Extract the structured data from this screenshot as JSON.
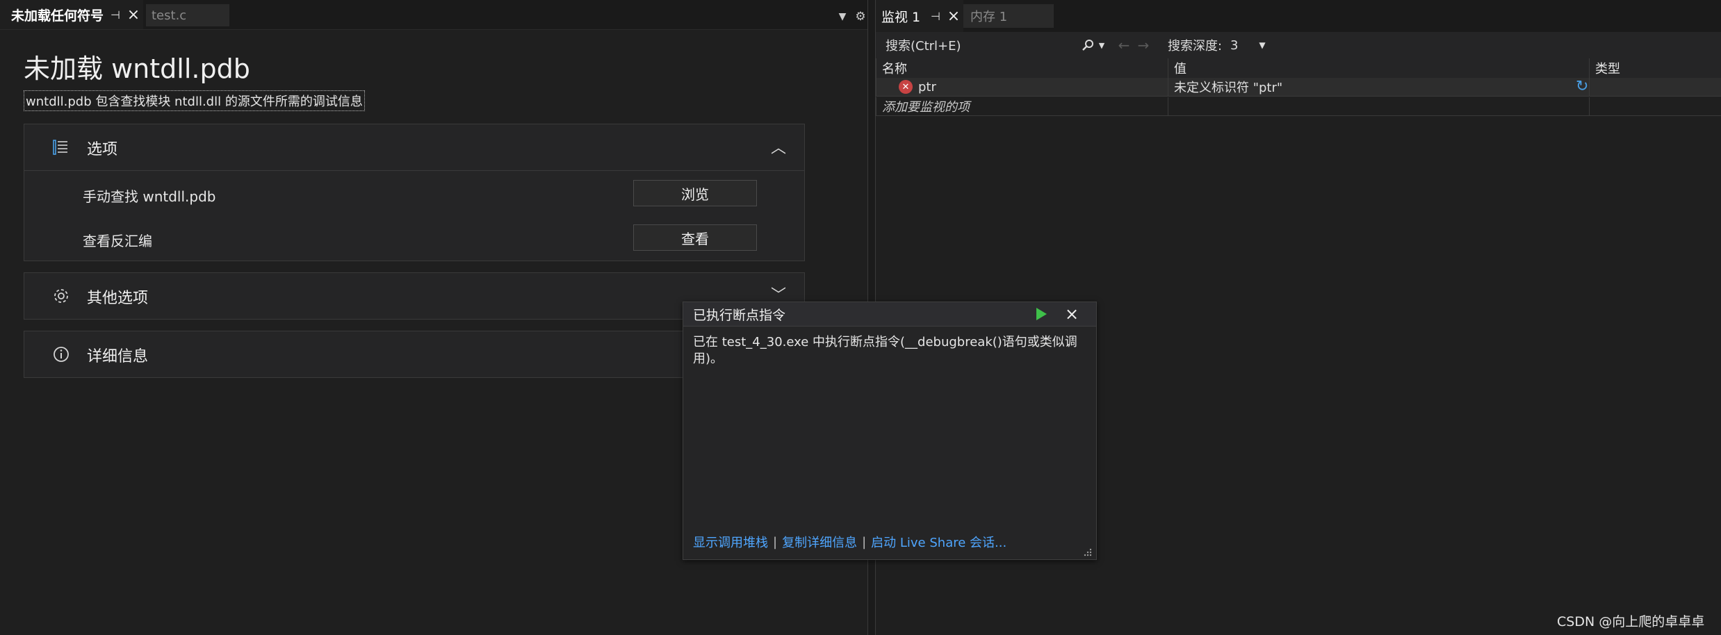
{
  "left_tabs": {
    "active": "未加载任何符号",
    "inactive": "test.c"
  },
  "doc": {
    "title": "未加载 wntdll.pdb",
    "description": "wntdll.pdb 包含查找模块 ntdll.dll 的源文件所需的调试信息",
    "options": {
      "label": "选项",
      "rows": [
        {
          "label": "手动查找 wntdll.pdb",
          "button": "浏览"
        },
        {
          "label": "查看反汇编",
          "button": "查看"
        }
      ]
    },
    "other_options_label": "其他选项",
    "details_label": "详细信息"
  },
  "right_tabs": {
    "watch": "监视 1",
    "memory": "内存 1"
  },
  "watch": {
    "search_placeholder": "搜索(Ctrl+E)",
    "depth_label": "搜索深度:",
    "depth_value": "3",
    "columns": [
      "名称",
      "值",
      "类型"
    ],
    "rows": [
      {
        "name": "ptr",
        "value": "未定义标识符 \"ptr\"",
        "type": ""
      }
    ],
    "add_item": "添加要监视的项"
  },
  "popup": {
    "title": "已执行断点指令",
    "message": "已在 test_4_30.exe 中执行断点指令(__debugbreak()语句或类似调用)。",
    "links": [
      "显示调用堆栈",
      "复制详细信息",
      "启动 Live Share 会话..."
    ]
  },
  "watermark": "CSDN @向上爬的卓卓卓",
  "colors": {
    "accent_link": "#4fa6ff",
    "play_green": "#3fc04a",
    "error_red": "#c74343"
  }
}
